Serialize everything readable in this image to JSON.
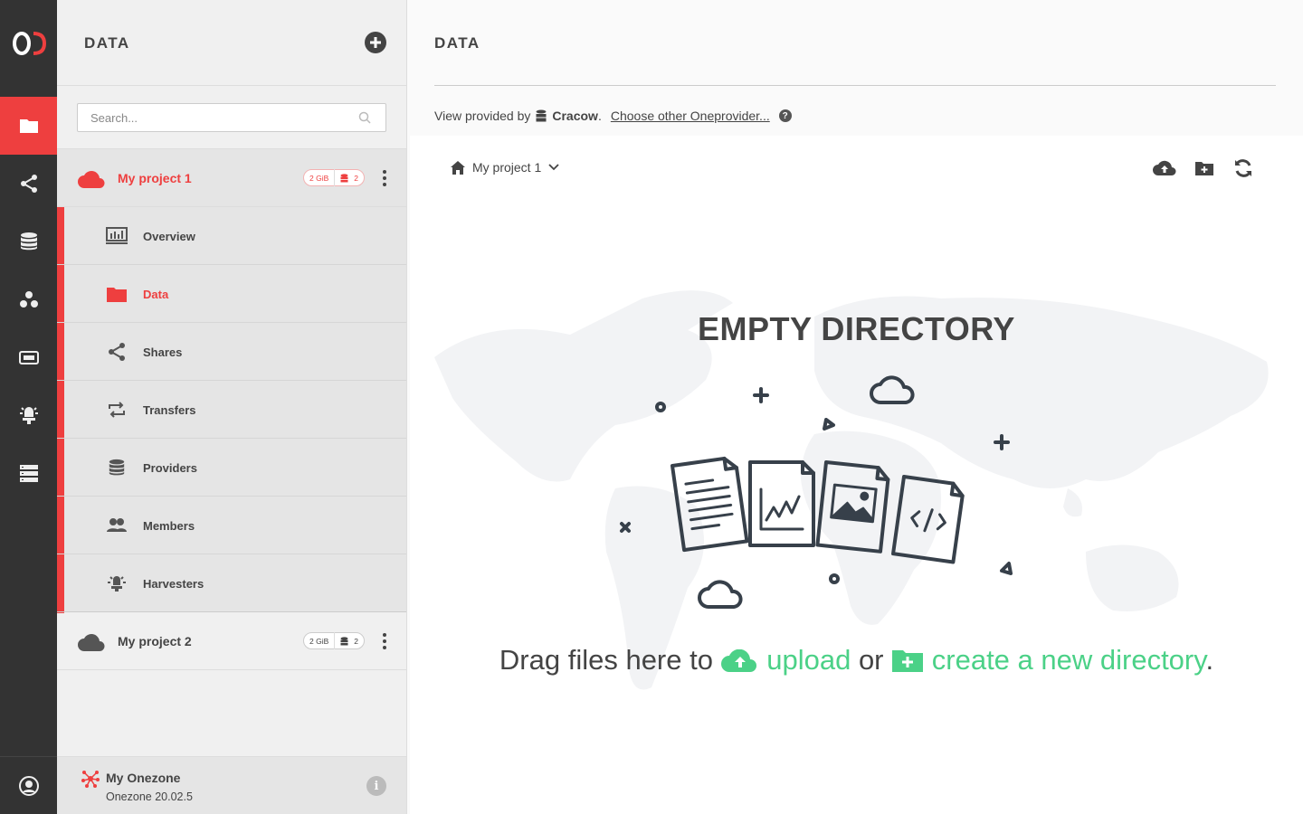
{
  "rail": {
    "logo": "OD",
    "items": [
      "data",
      "shares",
      "providers",
      "groups",
      "tokens",
      "harvesters",
      "clusters"
    ],
    "active": "data"
  },
  "sidebar": {
    "title": "DATA",
    "search_placeholder": "Search...",
    "spaces": [
      {
        "name": "My project 1",
        "size": "2 GiB",
        "providers": "2",
        "active": true
      },
      {
        "name": "My project 2",
        "size": "2 GiB",
        "providers": "2",
        "active": false
      }
    ],
    "subitems": [
      "Overview",
      "Data",
      "Shares",
      "Transfers",
      "Providers",
      "Members",
      "Harvesters"
    ],
    "active_subitem": "Data",
    "footer": {
      "name": "My Onezone",
      "version": "Onezone 20.02.5"
    }
  },
  "main": {
    "title": "DATA",
    "view_provided_by": "View provided by",
    "provider_name": "Cracow",
    "choose_other": "Choose other Oneprovider...",
    "breadcrumb": "My project 1",
    "empty_title": "EMPTY DIRECTORY",
    "drag_prefix": "Drag files here to",
    "upload": "upload",
    "or": "or",
    "create_dir": "create a new directory",
    "period": "."
  },
  "colors": {
    "accent": "#ee3f3f",
    "green": "#4bd187",
    "rail": "#333333"
  }
}
